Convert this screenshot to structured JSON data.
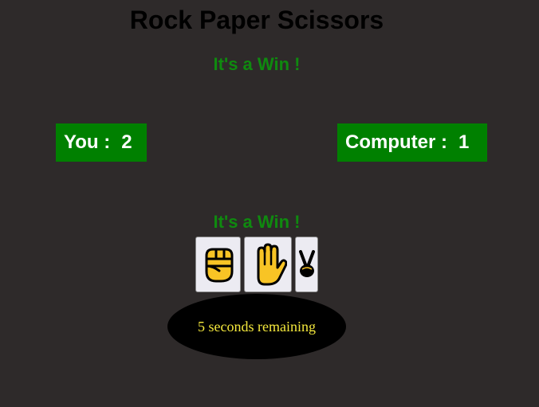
{
  "game": {
    "title": "Rock Paper Scissors",
    "result_top": "It's a Win !",
    "result_middle": "It's a Win !"
  },
  "scores": {
    "you_label": "You :",
    "you_value": "2",
    "computer_label": "Computer :",
    "computer_value": "1"
  },
  "choices": [
    {
      "name": "rock",
      "icon": "raised-fist-icon"
    },
    {
      "name": "paper",
      "icon": "raised-hand-icon"
    },
    {
      "name": "scissors",
      "icon": "victory-hand-icon"
    }
  ],
  "timer": {
    "text": "5 seconds remaining"
  },
  "colors": {
    "background": "#2e2a2a",
    "score_box": "#008000",
    "result_text": "#0f8a0f",
    "timer_bg": "#000000",
    "timer_text": "#f4e83c",
    "emoji_yellow": "#f8c425"
  }
}
